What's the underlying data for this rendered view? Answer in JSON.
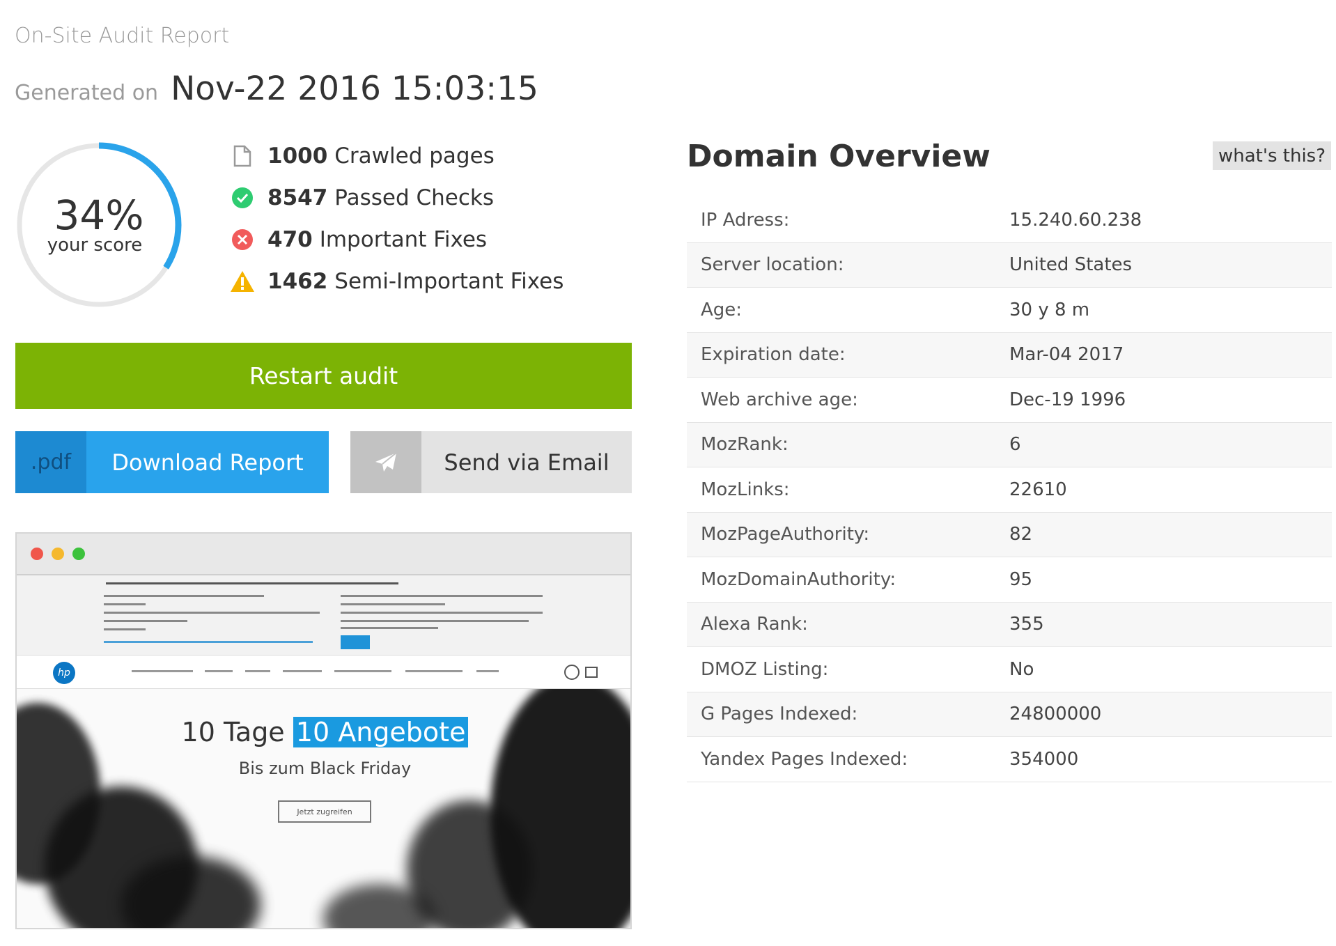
{
  "header": {
    "title": "On-Site Audit Report",
    "generated_label": "Generated on",
    "generated_date": "Nov-22 2016 15:03:15"
  },
  "score": {
    "value": 34,
    "percent_label": "34%",
    "sub_label": "your score",
    "ring_color": "#2aa3ea",
    "track_color": "#e6e6e6"
  },
  "stats": [
    {
      "icon": "document-icon",
      "count": "1000",
      "label": "Crawled pages"
    },
    {
      "icon": "check-circle-icon",
      "count": "8547",
      "label": "Passed Checks",
      "color": "#2ecc71"
    },
    {
      "icon": "error-circle-icon",
      "count": "470",
      "label": "Important Fixes",
      "color": "#f15b5b"
    },
    {
      "icon": "warning-triangle-icon",
      "count": "1462",
      "label": "Semi-Important Fixes",
      "color": "#f5b300"
    }
  ],
  "actions": {
    "restart_label": "Restart audit",
    "download_tag": ".pdf",
    "download_label": "Download Report",
    "email_label": "Send via Email"
  },
  "preview": {
    "headline_plain": "10 Tage",
    "headline_highlight": "10 Angebote",
    "subheadline": "Bis zum Black Friday",
    "cta": "Jetzt zugreifen",
    "logo": "hp"
  },
  "domain_overview": {
    "title": "Domain Overview",
    "help_label": "what's this?",
    "rows": [
      {
        "key": "IP Adress:",
        "value": "15.240.60.238"
      },
      {
        "key": "Server location:",
        "value": "United States"
      },
      {
        "key": "Age:",
        "value": "30 y 8 m"
      },
      {
        "key": "Expiration date:",
        "value": "Mar-04 2017"
      },
      {
        "key": "Web archive age:",
        "value": "Dec-19 1996"
      },
      {
        "key": "MozRank:",
        "value": "6"
      },
      {
        "key": "MozLinks:",
        "value": "22610"
      },
      {
        "key": "MozPageAuthority:",
        "value": "82"
      },
      {
        "key": "MozDomainAuthority:",
        "value": "95"
      },
      {
        "key": "Alexa Rank:",
        "value": "355"
      },
      {
        "key": "DMOZ Listing:",
        "value": "No"
      },
      {
        "key": "G Pages Indexed:",
        "value": "24800000"
      },
      {
        "key": "Yandex Pages Indexed:",
        "value": "354000"
      }
    ]
  }
}
